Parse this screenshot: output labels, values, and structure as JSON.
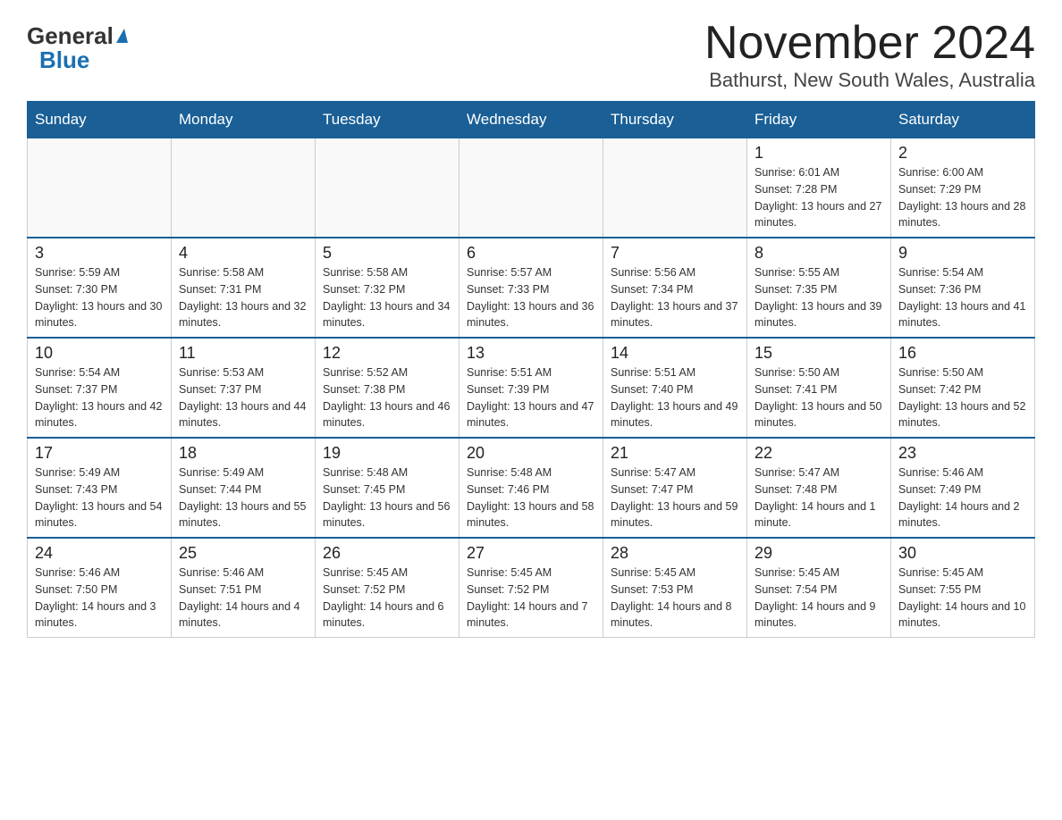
{
  "header": {
    "logo_text": "General",
    "logo_blue": "Blue",
    "month": "November 2024",
    "location": "Bathurst, New South Wales, Australia"
  },
  "days_of_week": [
    "Sunday",
    "Monday",
    "Tuesday",
    "Wednesday",
    "Thursday",
    "Friday",
    "Saturday"
  ],
  "weeks": [
    [
      {
        "day": "",
        "info": ""
      },
      {
        "day": "",
        "info": ""
      },
      {
        "day": "",
        "info": ""
      },
      {
        "day": "",
        "info": ""
      },
      {
        "day": "",
        "info": ""
      },
      {
        "day": "1",
        "info": "Sunrise: 6:01 AM\nSunset: 7:28 PM\nDaylight: 13 hours and 27 minutes."
      },
      {
        "day": "2",
        "info": "Sunrise: 6:00 AM\nSunset: 7:29 PM\nDaylight: 13 hours and 28 minutes."
      }
    ],
    [
      {
        "day": "3",
        "info": "Sunrise: 5:59 AM\nSunset: 7:30 PM\nDaylight: 13 hours and 30 minutes."
      },
      {
        "day": "4",
        "info": "Sunrise: 5:58 AM\nSunset: 7:31 PM\nDaylight: 13 hours and 32 minutes."
      },
      {
        "day": "5",
        "info": "Sunrise: 5:58 AM\nSunset: 7:32 PM\nDaylight: 13 hours and 34 minutes."
      },
      {
        "day": "6",
        "info": "Sunrise: 5:57 AM\nSunset: 7:33 PM\nDaylight: 13 hours and 36 minutes."
      },
      {
        "day": "7",
        "info": "Sunrise: 5:56 AM\nSunset: 7:34 PM\nDaylight: 13 hours and 37 minutes."
      },
      {
        "day": "8",
        "info": "Sunrise: 5:55 AM\nSunset: 7:35 PM\nDaylight: 13 hours and 39 minutes."
      },
      {
        "day": "9",
        "info": "Sunrise: 5:54 AM\nSunset: 7:36 PM\nDaylight: 13 hours and 41 minutes."
      }
    ],
    [
      {
        "day": "10",
        "info": "Sunrise: 5:54 AM\nSunset: 7:37 PM\nDaylight: 13 hours and 42 minutes."
      },
      {
        "day": "11",
        "info": "Sunrise: 5:53 AM\nSunset: 7:37 PM\nDaylight: 13 hours and 44 minutes."
      },
      {
        "day": "12",
        "info": "Sunrise: 5:52 AM\nSunset: 7:38 PM\nDaylight: 13 hours and 46 minutes."
      },
      {
        "day": "13",
        "info": "Sunrise: 5:51 AM\nSunset: 7:39 PM\nDaylight: 13 hours and 47 minutes."
      },
      {
        "day": "14",
        "info": "Sunrise: 5:51 AM\nSunset: 7:40 PM\nDaylight: 13 hours and 49 minutes."
      },
      {
        "day": "15",
        "info": "Sunrise: 5:50 AM\nSunset: 7:41 PM\nDaylight: 13 hours and 50 minutes."
      },
      {
        "day": "16",
        "info": "Sunrise: 5:50 AM\nSunset: 7:42 PM\nDaylight: 13 hours and 52 minutes."
      }
    ],
    [
      {
        "day": "17",
        "info": "Sunrise: 5:49 AM\nSunset: 7:43 PM\nDaylight: 13 hours and 54 minutes."
      },
      {
        "day": "18",
        "info": "Sunrise: 5:49 AM\nSunset: 7:44 PM\nDaylight: 13 hours and 55 minutes."
      },
      {
        "day": "19",
        "info": "Sunrise: 5:48 AM\nSunset: 7:45 PM\nDaylight: 13 hours and 56 minutes."
      },
      {
        "day": "20",
        "info": "Sunrise: 5:48 AM\nSunset: 7:46 PM\nDaylight: 13 hours and 58 minutes."
      },
      {
        "day": "21",
        "info": "Sunrise: 5:47 AM\nSunset: 7:47 PM\nDaylight: 13 hours and 59 minutes."
      },
      {
        "day": "22",
        "info": "Sunrise: 5:47 AM\nSunset: 7:48 PM\nDaylight: 14 hours and 1 minute."
      },
      {
        "day": "23",
        "info": "Sunrise: 5:46 AM\nSunset: 7:49 PM\nDaylight: 14 hours and 2 minutes."
      }
    ],
    [
      {
        "day": "24",
        "info": "Sunrise: 5:46 AM\nSunset: 7:50 PM\nDaylight: 14 hours and 3 minutes."
      },
      {
        "day": "25",
        "info": "Sunrise: 5:46 AM\nSunset: 7:51 PM\nDaylight: 14 hours and 4 minutes."
      },
      {
        "day": "26",
        "info": "Sunrise: 5:45 AM\nSunset: 7:52 PM\nDaylight: 14 hours and 6 minutes."
      },
      {
        "day": "27",
        "info": "Sunrise: 5:45 AM\nSunset: 7:52 PM\nDaylight: 14 hours and 7 minutes."
      },
      {
        "day": "28",
        "info": "Sunrise: 5:45 AM\nSunset: 7:53 PM\nDaylight: 14 hours and 8 minutes."
      },
      {
        "day": "29",
        "info": "Sunrise: 5:45 AM\nSunset: 7:54 PM\nDaylight: 14 hours and 9 minutes."
      },
      {
        "day": "30",
        "info": "Sunrise: 5:45 AM\nSunset: 7:55 PM\nDaylight: 14 hours and 10 minutes."
      }
    ]
  ]
}
